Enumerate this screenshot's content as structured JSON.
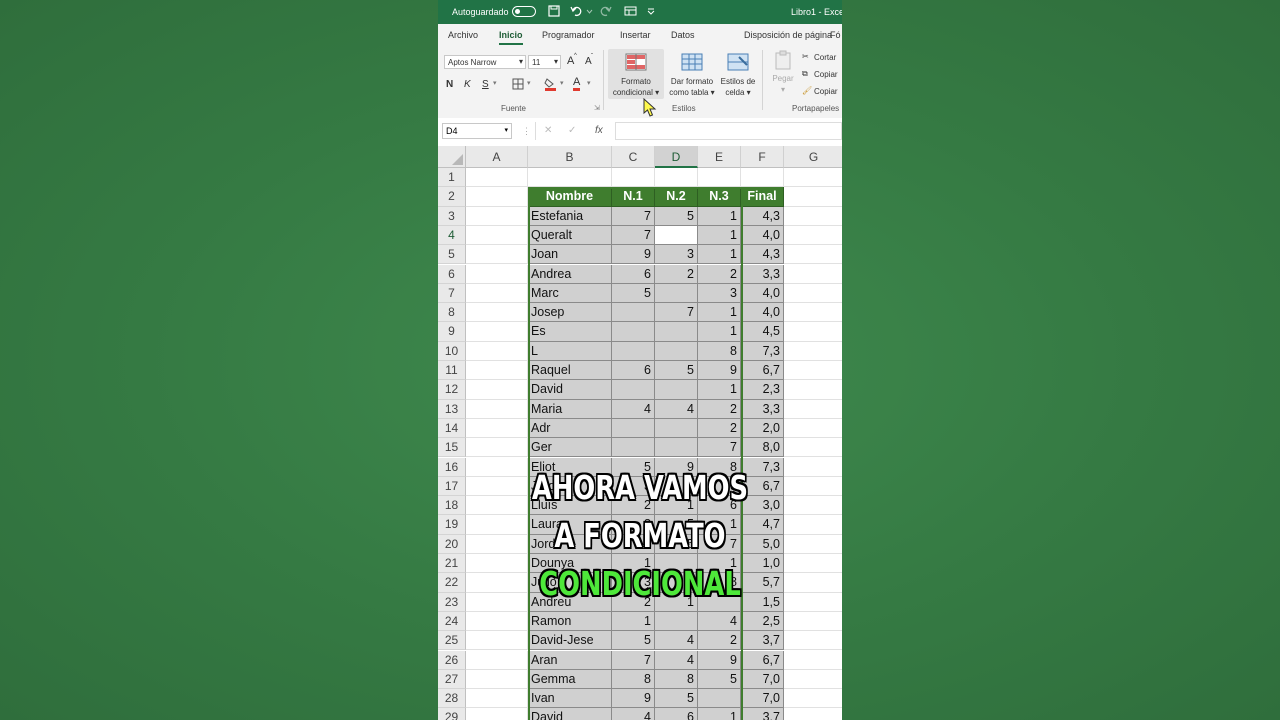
{
  "app": {
    "autosave_label": "Autoguardado",
    "autosave_state": "",
    "doc_title": "Libro1 - Excel"
  },
  "tabs": [
    "Archivo",
    "Inicio",
    "Programador",
    "Insertar",
    "Datos",
    "Disposición de página",
    "Fó"
  ],
  "ribbon": {
    "font_name": "Aptos Narrow",
    "font_size": "11",
    "grow_font": "A",
    "shrink_font": "A",
    "bold": "N",
    "italic": "K",
    "underline": "S",
    "font_color_letter": "A",
    "group_font": "Fuente",
    "cond_format": [
      "Formato",
      "condicional"
    ],
    "format_table": [
      "Dar formato",
      "como tabla"
    ],
    "cell_styles": [
      "Estilos de",
      "celda"
    ],
    "group_styles": "Estilos",
    "paste": "Pegar",
    "cut": "Cortar",
    "copy": "Copiar",
    "copy_format": "Copiar",
    "group_clipboard": "Portapapeles"
  },
  "formula_bar": {
    "name_box": "D4",
    "fx": "fx",
    "value": ""
  },
  "columns": [
    "A",
    "B",
    "C",
    "D",
    "E",
    "F",
    "G"
  ],
  "selected_column": "D",
  "selected_row": "4",
  "table": {
    "headers": [
      "Nombre",
      "N.1",
      "N.2",
      "N.3",
      "Final"
    ],
    "rows": [
      {
        "r": "3",
        "name": "Estefania",
        "n1": "7",
        "n2": "5",
        "n3": "1",
        "final": "4,3"
      },
      {
        "r": "4",
        "name": "Queralt",
        "n1": "7",
        "n2": "",
        "n3": "1",
        "final": "4,0"
      },
      {
        "r": "5",
        "name": "Joan",
        "n1": "9",
        "n2": "3",
        "n3": "1",
        "final": "4,3"
      },
      {
        "r": "6",
        "name": "Andrea",
        "n1": "6",
        "n2": "2",
        "n3": "2",
        "final": "3,3"
      },
      {
        "r": "7",
        "name": "Marc",
        "n1": "5",
        "n2": "",
        "n3": "3",
        "final": "4,0"
      },
      {
        "r": "8",
        "name": "Josep",
        "n1": "",
        "n2": "7",
        "n3": "1",
        "final": "4,0"
      },
      {
        "r": "9",
        "name": "Es",
        "n1": "",
        "n2": "",
        "n3": "1",
        "final": "4,5"
      },
      {
        "r": "10",
        "name": "L",
        "n1": "",
        "n2": "",
        "n3": "8",
        "final": "7,3"
      },
      {
        "r": "11",
        "name": "Raquel",
        "n1": "6",
        "n2": "5",
        "n3": "9",
        "final": "6,7"
      },
      {
        "r": "12",
        "name": "David",
        "n1": "",
        "n2": "",
        "n3": "1",
        "final": "2,3"
      },
      {
        "r": "13",
        "name": "Maria",
        "n1": "4",
        "n2": "4",
        "n3": "2",
        "final": "3,3"
      },
      {
        "r": "14",
        "name": "Adr",
        "n1": "",
        "n2": "",
        "n3": "2",
        "final": "2,0"
      },
      {
        "r": "15",
        "name": "Ger",
        "n1": "",
        "n2": "",
        "n3": "7",
        "final": "8,0"
      },
      {
        "r": "16",
        "name": "Eliot",
        "n1": "5",
        "n2": "9",
        "n3": "8",
        "final": "7,3"
      },
      {
        "r": "17",
        "name": "Jordi",
        "n1": "3",
        "n2": "9",
        "n3": "8",
        "final": "6,7"
      },
      {
        "r": "18",
        "name": "Lluís",
        "n1": "2",
        "n2": "1",
        "n3": "6",
        "final": "3,0"
      },
      {
        "r": "19",
        "name": "Laura",
        "n1": "8",
        "n2": "5",
        "n3": "1",
        "final": "4,7"
      },
      {
        "r": "20",
        "name": "Jordi",
        "n1": "3",
        "n2": "5",
        "n3": "7",
        "final": "5,0"
      },
      {
        "r": "21",
        "name": "Dounya",
        "n1": "1",
        "n2": "",
        "n3": "1",
        "final": "1,0"
      },
      {
        "r": "22",
        "name": "Julio",
        "n1": "3",
        "n2": "6",
        "n3": "8",
        "final": "5,7"
      },
      {
        "r": "23",
        "name": "Andreu",
        "n1": "2",
        "n2": "1",
        "n3": "",
        "final": "1,5"
      },
      {
        "r": "24",
        "name": "Ramon",
        "n1": "1",
        "n2": "",
        "n3": "4",
        "final": "2,5"
      },
      {
        "r": "25",
        "name": "David-Jese",
        "n1": "5",
        "n2": "4",
        "n3": "2",
        "final": "3,7"
      },
      {
        "r": "26",
        "name": "Aran",
        "n1": "7",
        "n2": "4",
        "n3": "9",
        "final": "6,7"
      },
      {
        "r": "27",
        "name": "Gemma",
        "n1": "8",
        "n2": "8",
        "n3": "5",
        "final": "7,0"
      },
      {
        "r": "28",
        "name": "Ivan",
        "n1": "9",
        "n2": "5",
        "n3": "",
        "final": "7,0"
      },
      {
        "r": "29",
        "name": "David",
        "n1": "4",
        "n2": "6",
        "n3": "1",
        "final": "3,7"
      }
    ]
  },
  "caption": {
    "line1": "AHORA VAMOS",
    "line2": "A FORMATO",
    "line3": "CONDICIONAL"
  },
  "colors": {
    "excel_green": "#217346",
    "table_header": "#3f7d2e",
    "table_body": "#d0d0d0",
    "caption_highlight": "#4ee83a"
  }
}
